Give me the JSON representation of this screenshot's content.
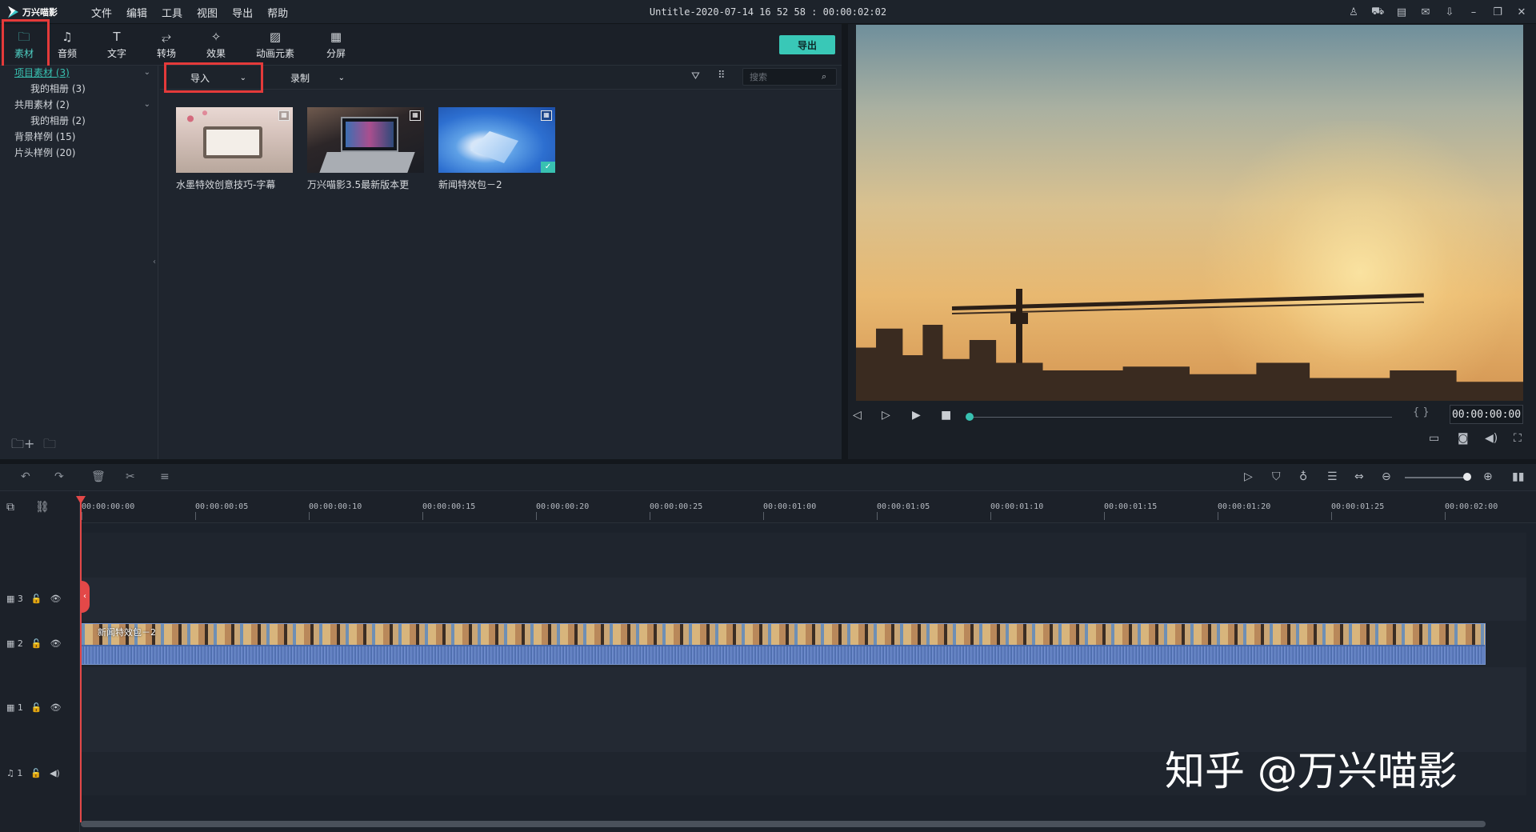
{
  "app": {
    "name": "万兴喵影",
    "title": "Untitle-2020-07-14 16 52 58 : 00:00:02:02"
  },
  "menu": [
    "文件",
    "编辑",
    "工具",
    "视图",
    "导出",
    "帮助"
  ],
  "sys_icons": [
    "user-icon",
    "cart-icon",
    "save-icon",
    "mail-icon",
    "download-icon",
    "minimize-icon",
    "restore-icon",
    "close-icon"
  ],
  "category_tabs": [
    {
      "label": "素材",
      "icon": "folder-icon",
      "active": true
    },
    {
      "label": "音频",
      "icon": "music-note-icon"
    },
    {
      "label": "文字",
      "icon": "text-icon"
    },
    {
      "label": "转场",
      "icon": "transition-icon"
    },
    {
      "label": "效果",
      "icon": "effects-icon"
    },
    {
      "label": "动画元素",
      "icon": "image-element-icon"
    },
    {
      "label": "分屏",
      "icon": "split-screen-icon"
    }
  ],
  "export_label": "导出",
  "sidebar": {
    "items": [
      {
        "label": "项目素材 (3)",
        "expanded": true
      },
      {
        "label": "我的相册 (3)"
      },
      {
        "label": "共用素材 (2)",
        "expanded": true
      },
      {
        "label": "我的相册 (2)"
      },
      {
        "label": "背景样例 (15)"
      },
      {
        "label": "片头样例 (20)"
      }
    ]
  },
  "media_toolbar": {
    "import_label": "导入",
    "record_label": "录制",
    "search_placeholder": "搜索"
  },
  "media_items": [
    {
      "label": "水墨特效创意技巧-字幕"
    },
    {
      "label": "万兴喵影3.5最新版本更"
    },
    {
      "label": "新闻特效包－2",
      "added": true
    }
  ],
  "preview": {
    "timecode": "00:00:00:00",
    "progress": 0
  },
  "timeline": {
    "ruler": [
      "00:00:00:00",
      "00:00:00:05",
      "00:00:00:10",
      "00:00:00:15",
      "00:00:00:20",
      "00:00:00:25",
      "00:00:01:00",
      "00:00:01:05",
      "00:00:01:10",
      "00:00:01:15",
      "00:00:01:20",
      "00:00:01:25",
      "00:00:02:00"
    ],
    "tracks": [
      {
        "label": "3",
        "type": "video"
      },
      {
        "label": "2",
        "type": "video"
      },
      {
        "label": "1",
        "type": "video"
      },
      {
        "label": "1",
        "type": "audio"
      }
    ],
    "clip_label": "新闻特效包－2",
    "zoom": 0.9
  },
  "watermark": "知乎 @万兴喵影",
  "colors": {
    "accent": "#38c1b1",
    "highlight": "#e43a3a",
    "playhead": "#e34848"
  }
}
